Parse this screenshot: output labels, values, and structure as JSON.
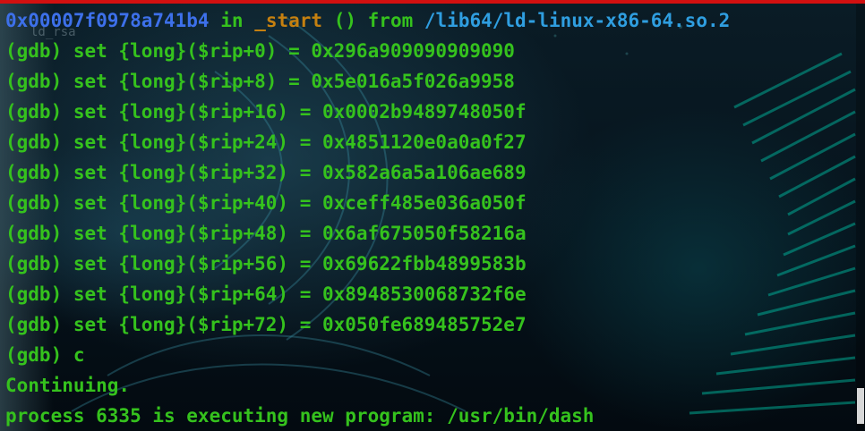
{
  "header_line": {
    "address": "0x00007f0978a741b4",
    "in_word": "in",
    "function": "_start",
    "parens": "()",
    "from_word": "from",
    "library": "/lib64/ld-linux-x86-64.so.2"
  },
  "background_label": "ld_rsa",
  "commands": [
    "(gdb) set {long}($rip+0) = 0x296a909090909090",
    "(gdb) set {long}($rip+8) = 0x5e016a5f026a9958",
    "(gdb) set {long}($rip+16) = 0x0002b9489748050f",
    "(gdb) set {long}($rip+24) = 0x4851120e0a0a0f27",
    "(gdb) set {long}($rip+32) = 0x582a6a5a106ae689",
    "(gdb) set {long}($rip+40) = 0xceff485e036a050f",
    "(gdb) set {long}($rip+48) = 0x6af675050f58216a",
    "(gdb) set {long}($rip+56) = 0x69622fbb4899583b",
    "(gdb) set {long}($rip+64) = 0x8948530068732f6e",
    "(gdb) set {long}($rip+72) = 0x050fe689485752e7",
    "(gdb) c"
  ],
  "output_lines": [
    "Continuing.",
    "process 6335 is executing new program: /usr/bin/dash"
  ],
  "colors": {
    "green_text": "#35c21d",
    "address_blue": "#3d70ea",
    "function_orange": "#c58010",
    "path_blue": "#2f9ee0",
    "top_accent_red": "#d21010"
  }
}
